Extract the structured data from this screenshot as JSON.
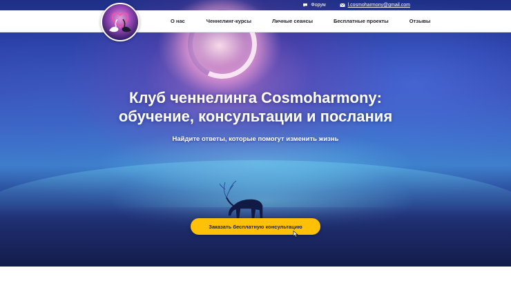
{
  "topbar": {
    "forum_label": "Форум",
    "email_label": "l.cosmoharmony@gmail.com"
  },
  "nav": {
    "items": [
      {
        "label": "О нас"
      },
      {
        "label": "Ченнелинг-курсы"
      },
      {
        "label": "Личные сеансы"
      },
      {
        "label": "Бесплатные проекты"
      },
      {
        "label": "Отзывы"
      }
    ]
  },
  "hero": {
    "title_line1": "Клуб ченнелинга Cosmoharmony:",
    "title_line2": "обучение, консультации и послания",
    "subtitle": "Найдите ответы, которые помогут изменить жизнь",
    "cta_label": "Заказать бесплатную консультацию"
  },
  "colors": {
    "accent": "#ffc107",
    "nav_text": "#1d1d2a",
    "hero_text": "#ffffff"
  },
  "icons": [
    "chat-bubble-icon",
    "envelope-icon",
    "swan-logo"
  ]
}
